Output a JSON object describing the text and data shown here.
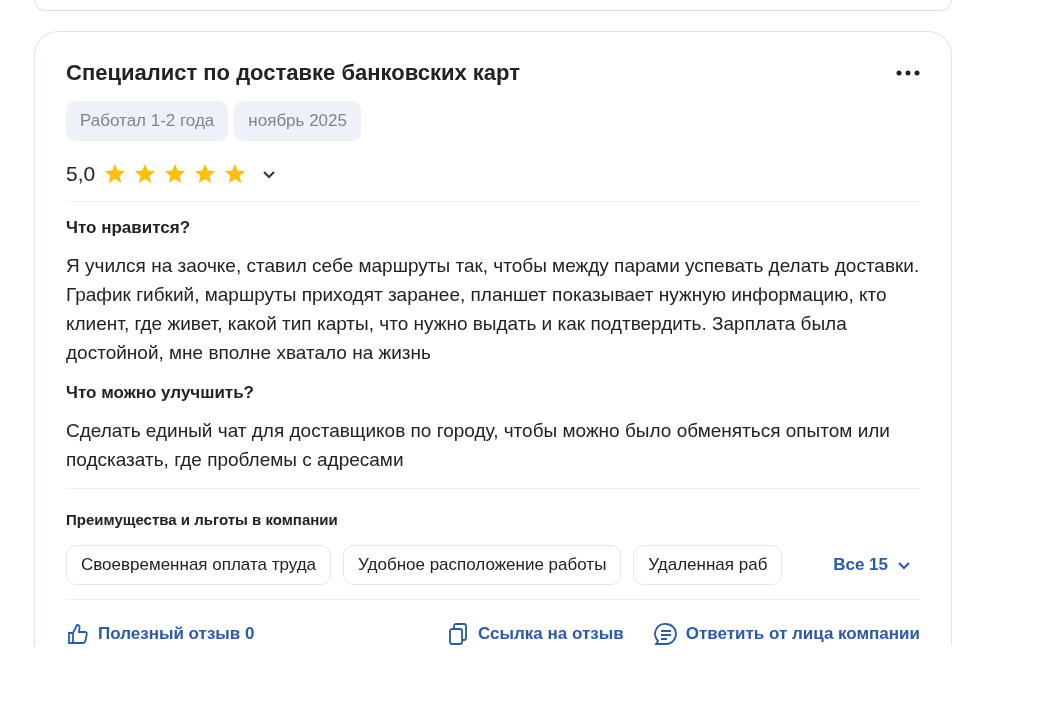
{
  "review": {
    "title": "Специалист по доставке банковских карт",
    "tags": [
      "Работал 1-2 года",
      "ноябрь 2025"
    ],
    "rating": "5,0",
    "stars": 5,
    "sections": [
      {
        "heading": "Что нравится?",
        "text": "Я учился на заочке, ставил себе маршруты так, чтобы между парами успевать делать доставки. График гибкий, маршруты приходят заранее, планшет показывает нужную информацию, кто клиент, где живет, какой тип карты, что нужно выдать и как подтвердить. Зарплата была достойной, мне вполне хватало на жизнь"
      },
      {
        "heading": "Что можно улучшить?",
        "text": "Сделать единый чат для доставщиков по городу, чтобы можно было обменяться опытом или подсказать, где проблемы с адресами"
      }
    ],
    "benefits": {
      "heading": "Преимущества и льготы в компании",
      "items": [
        "Своевременная оплата труда",
        "Удобное расположение работы",
        "Удаленная раб"
      ],
      "more": "Все 15"
    },
    "actions": [
      {
        "kind": "like",
        "label": "Полезный отзыв 0"
      },
      {
        "kind": "link",
        "label": "Ссылка на отзыв"
      },
      {
        "kind": "reply",
        "label": "Ответить от лица компании"
      }
    ]
  }
}
